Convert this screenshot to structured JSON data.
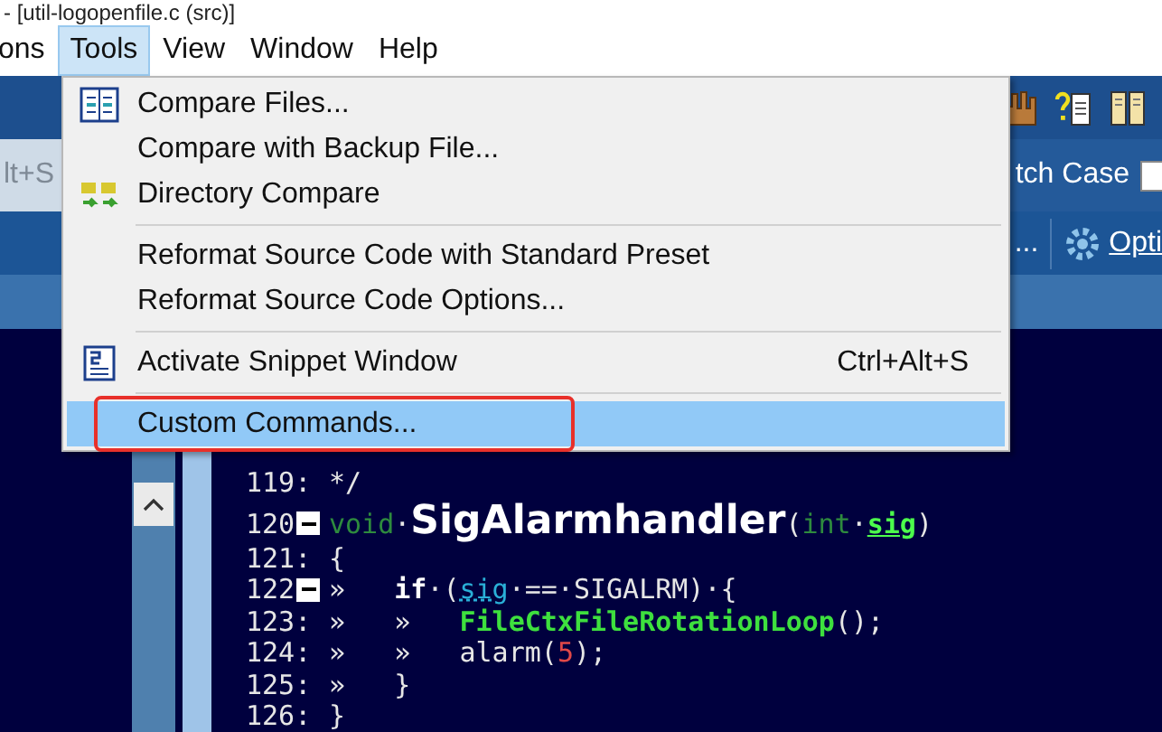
{
  "window": {
    "title": "- [util-logopenfile.c (src)]"
  },
  "menubar": [
    {
      "label": "ons",
      "selected": false
    },
    {
      "label": "Tools",
      "selected": true
    },
    {
      "label": "View",
      "selected": false
    },
    {
      "label": "Window",
      "selected": false
    },
    {
      "label": "Help",
      "selected": false
    }
  ],
  "toolbar": {
    "search_shortcut": "lt+S",
    "match_case": {
      "label": "tch Case",
      "checked": false
    },
    "ellipsis": "...",
    "options_link": "Opti"
  },
  "tools_menu": {
    "groups": [
      [
        {
          "label": "Compare Files...",
          "selected": false,
          "outlined": false
        },
        {
          "label": "Compare with Backup File...",
          "selected": false,
          "outlined": false
        },
        {
          "label": "Directory Compare",
          "selected": false,
          "outlined": false
        }
      ],
      [
        {
          "label": "Reformat Source Code with Standard Preset",
          "selected": false,
          "outlined": false
        },
        {
          "label": "Reformat Source Code Options...",
          "selected": false,
          "outlined": false
        }
      ],
      [
        {
          "label": "Activate Snippet Window",
          "shortcut": "Ctrl+Alt+S",
          "selected": false,
          "outlined": false
        }
      ],
      [
        {
          "label": "Custom Commands...",
          "selected": true,
          "outlined": true
        }
      ]
    ]
  },
  "editor": {
    "lines": [
      {
        "number": "119:",
        "fold": false,
        "tokens": [
          {
            "t": "*/",
            "kind": "plain"
          }
        ]
      },
      {
        "number": "120",
        "fold": true,
        "tokens": [
          {
            "t": "void",
            "kind": "kw"
          },
          {
            "t": "·",
            "kind": "plain"
          },
          {
            "t": "SigAlarmhandler",
            "kind": "fn"
          },
          {
            "t": "(",
            "kind": "plain"
          },
          {
            "t": "int",
            "kind": "kw"
          },
          {
            "t": "·",
            "kind": "plain"
          },
          {
            "t": "sig",
            "kind": "param"
          },
          {
            "t": ")",
            "kind": "plain"
          }
        ]
      },
      {
        "number": "121:",
        "fold": false,
        "tokens": [
          {
            "t": "{",
            "kind": "plain"
          }
        ]
      },
      {
        "number": "122",
        "fold": true,
        "tokens": [
          {
            "t": "»   ",
            "kind": "plain"
          },
          {
            "t": "if",
            "kind": "bold"
          },
          {
            "t": "·(",
            "kind": "plain"
          },
          {
            "t": "sig",
            "kind": "param2"
          },
          {
            "t": "·==·SIGALRM)·{",
            "kind": "plain"
          }
        ]
      },
      {
        "number": "123:",
        "fold": false,
        "tokens": [
          {
            "t": "»   »   ",
            "kind": "plain"
          },
          {
            "t": "FileCtxFileRotationLoop",
            "kind": "call"
          },
          {
            "t": "();",
            "kind": "plain"
          }
        ]
      },
      {
        "number": "124:",
        "fold": false,
        "tokens": [
          {
            "t": "»   »   alarm(",
            "kind": "plain"
          },
          {
            "t": "5",
            "kind": "num"
          },
          {
            "t": ");",
            "kind": "plain"
          }
        ]
      },
      {
        "number": "125:",
        "fold": false,
        "tokens": [
          {
            "t": "»   }",
            "kind": "plain"
          }
        ]
      },
      {
        "number": "126:",
        "fold": false,
        "tokens": [
          {
            "t": "}",
            "kind": "plain"
          }
        ]
      }
    ]
  }
}
